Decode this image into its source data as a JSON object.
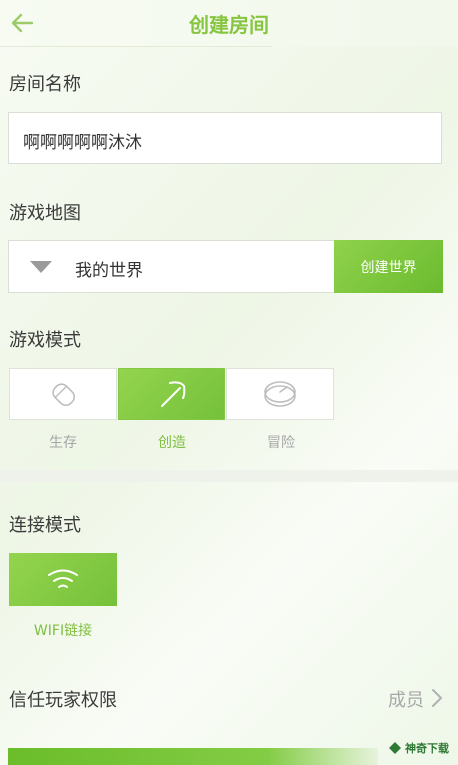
{
  "header": {
    "title": "创建房间",
    "back_icon": "arrow-left-icon",
    "accent": "#86c540"
  },
  "room_name": {
    "label": "房间名称",
    "value": "啊啊啊啊啊沐沐"
  },
  "game_map": {
    "label": "游戏地图",
    "selected": "我的世界",
    "create_button": "创建世界"
  },
  "game_mode": {
    "label": "游戏模式",
    "options": [
      {
        "label": "生存",
        "icon": "survival-icon",
        "selected": false
      },
      {
        "label": "创造",
        "icon": "pickaxe-icon",
        "selected": true
      },
      {
        "label": "冒险",
        "icon": "adventure-icon",
        "selected": false
      }
    ]
  },
  "connection": {
    "label": "连接模式",
    "option": "WIFI链接",
    "icon": "wifi-icon"
  },
  "trust": {
    "label": "信任玩家权限",
    "value": "成员"
  },
  "watermark": {
    "text": "神奇下载"
  }
}
